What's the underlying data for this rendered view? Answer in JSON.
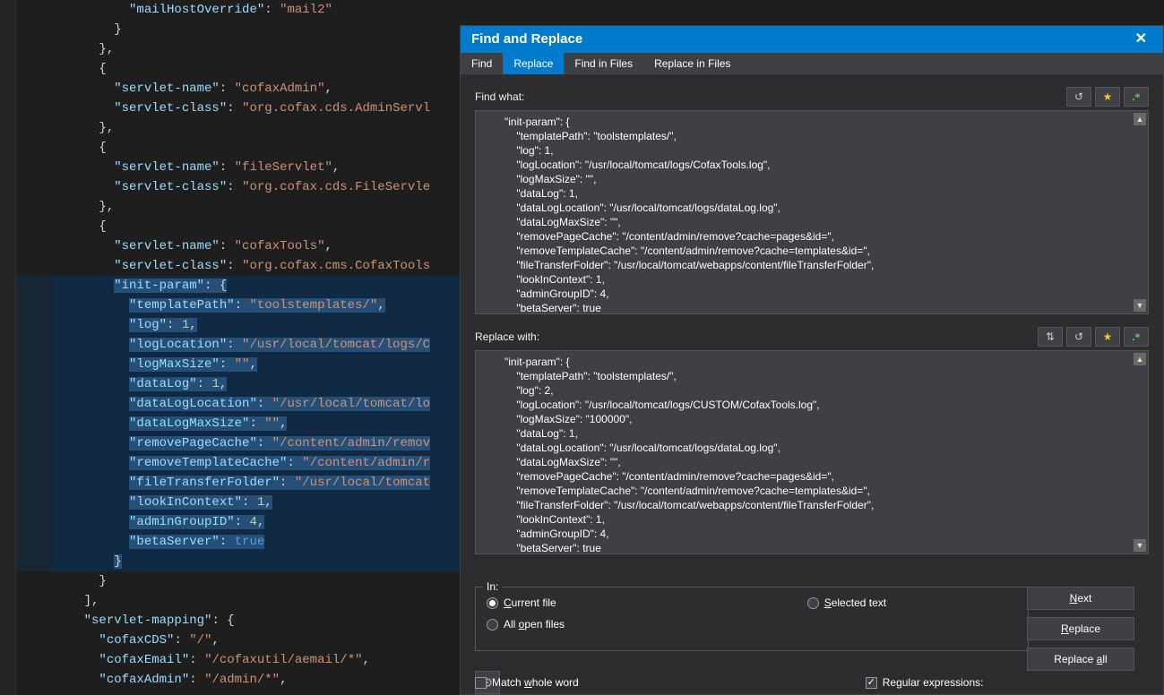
{
  "editor": {
    "lines": [
      {
        "indent": 5,
        "tokens": [
          {
            "t": "key",
            "v": "\"mailHostOverride\""
          },
          {
            "t": "punct",
            "v": ": "
          },
          {
            "t": "string",
            "v": "\"mail2\""
          }
        ]
      },
      {
        "indent": 4,
        "tokens": [
          {
            "t": "punct",
            "v": "}"
          }
        ]
      },
      {
        "indent": 3,
        "tokens": [
          {
            "t": "punct",
            "v": "},"
          }
        ]
      },
      {
        "indent": 3,
        "tokens": [
          {
            "t": "punct",
            "v": "{"
          }
        ]
      },
      {
        "indent": 4,
        "tokens": [
          {
            "t": "key",
            "v": "\"servlet-name\""
          },
          {
            "t": "punct",
            "v": ": "
          },
          {
            "t": "string",
            "v": "\"cofaxAdmin\""
          },
          {
            "t": "punct",
            "v": ","
          }
        ]
      },
      {
        "indent": 4,
        "tokens": [
          {
            "t": "key",
            "v": "\"servlet-class\""
          },
          {
            "t": "punct",
            "v": ": "
          },
          {
            "t": "string",
            "v": "\"org.cofax.cds.AdminServl"
          }
        ]
      },
      {
        "indent": 3,
        "tokens": [
          {
            "t": "punct",
            "v": "},"
          }
        ]
      },
      {
        "indent": 3,
        "tokens": [
          {
            "t": "punct",
            "v": "{"
          }
        ]
      },
      {
        "indent": 4,
        "tokens": [
          {
            "t": "key",
            "v": "\"servlet-name\""
          },
          {
            "t": "punct",
            "v": ": "
          },
          {
            "t": "string",
            "v": "\"fileServlet\""
          },
          {
            "t": "punct",
            "v": ","
          }
        ]
      },
      {
        "indent": 4,
        "tokens": [
          {
            "t": "key",
            "v": "\"servlet-class\""
          },
          {
            "t": "punct",
            "v": ": "
          },
          {
            "t": "string",
            "v": "\"org.cofax.cds.FileServle"
          }
        ]
      },
      {
        "indent": 3,
        "tokens": [
          {
            "t": "punct",
            "v": "},"
          }
        ]
      },
      {
        "indent": 3,
        "tokens": [
          {
            "t": "punct",
            "v": "{"
          }
        ]
      },
      {
        "indent": 4,
        "tokens": [
          {
            "t": "key",
            "v": "\"servlet-name\""
          },
          {
            "t": "punct",
            "v": ": "
          },
          {
            "t": "string",
            "v": "\"cofaxTools\""
          },
          {
            "t": "punct",
            "v": ","
          }
        ]
      },
      {
        "indent": 4,
        "tokens": [
          {
            "t": "key",
            "v": "\"servlet-class\""
          },
          {
            "t": "punct",
            "v": ": "
          },
          {
            "t": "string",
            "v": "\"org.cofax.cms.CofaxTools"
          }
        ]
      },
      {
        "indent": 4,
        "sel": true,
        "tokens": [
          {
            "t": "key",
            "v": "\"init-param\""
          },
          {
            "t": "punct",
            "v": ": {"
          }
        ]
      },
      {
        "indent": 5,
        "sel": true,
        "tokens": [
          {
            "t": "key",
            "v": "\"templatePath\""
          },
          {
            "t": "punct",
            "v": ": "
          },
          {
            "t": "string",
            "v": "\"toolstemplates/\""
          },
          {
            "t": "punct",
            "v": ","
          }
        ]
      },
      {
        "indent": 5,
        "sel": true,
        "tokens": [
          {
            "t": "key",
            "v": "\"log\""
          },
          {
            "t": "punct",
            "v": ": "
          },
          {
            "t": "number",
            "v": "1"
          },
          {
            "t": "punct",
            "v": ","
          }
        ]
      },
      {
        "indent": 5,
        "sel": true,
        "tokens": [
          {
            "t": "key",
            "v": "\"logLocation\""
          },
          {
            "t": "punct",
            "v": ": "
          },
          {
            "t": "string",
            "v": "\"/usr/local/tomcat/logs/C"
          }
        ]
      },
      {
        "indent": 5,
        "sel": true,
        "tokens": [
          {
            "t": "key",
            "v": "\"logMaxSize\""
          },
          {
            "t": "punct",
            "v": ": "
          },
          {
            "t": "string",
            "v": "\"\""
          },
          {
            "t": "punct",
            "v": ","
          }
        ]
      },
      {
        "indent": 5,
        "sel": true,
        "tokens": [
          {
            "t": "key",
            "v": "\"dataLog\""
          },
          {
            "t": "punct",
            "v": ": "
          },
          {
            "t": "number",
            "v": "1"
          },
          {
            "t": "punct",
            "v": ","
          }
        ]
      },
      {
        "indent": 5,
        "sel": true,
        "tokens": [
          {
            "t": "key",
            "v": "\"dataLogLocation\""
          },
          {
            "t": "punct",
            "v": ": "
          },
          {
            "t": "string",
            "v": "\"/usr/local/tomcat/lo"
          }
        ]
      },
      {
        "indent": 5,
        "sel": true,
        "tokens": [
          {
            "t": "key",
            "v": "\"dataLogMaxSize\""
          },
          {
            "t": "punct",
            "v": ": "
          },
          {
            "t": "string",
            "v": "\"\""
          },
          {
            "t": "punct",
            "v": ","
          }
        ]
      },
      {
        "indent": 5,
        "sel": true,
        "tokens": [
          {
            "t": "key",
            "v": "\"removePageCache\""
          },
          {
            "t": "punct",
            "v": ": "
          },
          {
            "t": "string",
            "v": "\"/content/admin/remov"
          }
        ]
      },
      {
        "indent": 5,
        "sel": true,
        "tokens": [
          {
            "t": "key",
            "v": "\"removeTemplateCache\""
          },
          {
            "t": "punct",
            "v": ": "
          },
          {
            "t": "string",
            "v": "\"/content/admin/r"
          }
        ]
      },
      {
        "indent": 5,
        "sel": true,
        "tokens": [
          {
            "t": "key",
            "v": "\"fileTransferFolder\""
          },
          {
            "t": "punct",
            "v": ": "
          },
          {
            "t": "string",
            "v": "\"/usr/local/tomcat"
          }
        ]
      },
      {
        "indent": 5,
        "sel": true,
        "tokens": [
          {
            "t": "key",
            "v": "\"lookInContext\""
          },
          {
            "t": "punct",
            "v": ": "
          },
          {
            "t": "number",
            "v": "1"
          },
          {
            "t": "punct",
            "v": ","
          }
        ]
      },
      {
        "indent": 5,
        "sel": true,
        "tokens": [
          {
            "t": "key",
            "v": "\"adminGroupID\""
          },
          {
            "t": "punct",
            "v": ": "
          },
          {
            "t": "number",
            "v": "4"
          },
          {
            "t": "punct",
            "v": ","
          }
        ]
      },
      {
        "indent": 5,
        "sel": true,
        "tokens": [
          {
            "t": "key",
            "v": "\"betaServer\""
          },
          {
            "t": "punct",
            "v": ": "
          },
          {
            "t": "kw",
            "v": "true"
          }
        ]
      },
      {
        "indent": 4,
        "sel": true,
        "tokens": [
          {
            "t": "punct",
            "v": "}"
          }
        ]
      },
      {
        "indent": 3,
        "tokens": [
          {
            "t": "punct",
            "v": "}"
          }
        ]
      },
      {
        "indent": 2,
        "tokens": [
          {
            "t": "punct",
            "v": "],"
          }
        ]
      },
      {
        "indent": 2,
        "tokens": [
          {
            "t": "key",
            "v": "\"servlet-mapping\""
          },
          {
            "t": "punct",
            "v": ": {"
          }
        ]
      },
      {
        "indent": 3,
        "tokens": [
          {
            "t": "key",
            "v": "\"cofaxCDS\""
          },
          {
            "t": "punct",
            "v": ": "
          },
          {
            "t": "string",
            "v": "\"/\""
          },
          {
            "t": "punct",
            "v": ","
          }
        ]
      },
      {
        "indent": 3,
        "tokens": [
          {
            "t": "key",
            "v": "\"cofaxEmail\""
          },
          {
            "t": "punct",
            "v": ": "
          },
          {
            "t": "string",
            "v": "\"/cofaxutil/aemail/*\""
          },
          {
            "t": "punct",
            "v": ","
          }
        ]
      },
      {
        "indent": 3,
        "tokens": [
          {
            "t": "key",
            "v": "\"cofaxAdmin\""
          },
          {
            "t": "punct",
            "v": ": "
          },
          {
            "t": "string",
            "v": "\"/admin/*\""
          },
          {
            "t": "punct",
            "v": ","
          }
        ]
      }
    ]
  },
  "dialog": {
    "title": "Find and Replace",
    "tabs": {
      "find": "Find",
      "replace": "Replace",
      "findfiles": "Find in Files",
      "replacefiles": "Replace in Files",
      "active": "replace"
    },
    "find_label": "Find what:",
    "replace_label": "Replace with:",
    "find_text": "\"init-param\": {\n    \"templatePath\": \"toolstemplates/\",\n    \"log\": 1,\n    \"logLocation\": \"/usr/local/tomcat/logs/CofaxTools.log\",\n    \"logMaxSize\": \"\",\n    \"dataLog\": 1,\n    \"dataLogLocation\": \"/usr/local/tomcat/logs/dataLog.log\",\n    \"dataLogMaxSize\": \"\",\n    \"removePageCache\": \"/content/admin/remove?cache=pages&id=\",\n    \"removeTemplateCache\": \"/content/admin/remove?cache=templates&id=\",\n    \"fileTransferFolder\": \"/usr/local/tomcat/webapps/content/fileTransferFolder\",\n    \"lookInContext\": 1,\n    \"adminGroupID\": 4,\n    \"betaServer\": true",
    "replace_text": "\"init-param\": {\n    \"templatePath\": \"toolstemplates/\",\n    \"log\": 2,\n    \"logLocation\": \"/usr/local/tomcat/logs/CUSTOM/CofaxTools.log\",\n    \"logMaxSize\": \"100000\",\n    \"dataLog\": 1,\n    \"dataLogLocation\": \"/usr/local/tomcat/logs/dataLog.log\",\n    \"dataLogMaxSize\": \"\",\n    \"removePageCache\": \"/content/admin/remove?cache=pages&id=\",\n    \"removeTemplateCache\": \"/content/admin/remove?cache=templates&id=\",\n    \"fileTransferFolder\": \"/usr/local/tomcat/webapps/content/fileTransferFolder\",\n    \"lookInContext\": 1,\n    \"adminGroupID\": 4,\n    \"betaServer\": true",
    "in_label": "In:",
    "scope": {
      "current": "Current file",
      "selected": "Selected text",
      "allopen": "All open files",
      "value": "current"
    },
    "options": {
      "match_whole": "Match whole word",
      "regex": "Regular expressions:",
      "regex_checked": true,
      "match_whole_checked": false
    },
    "buttons": {
      "next": "Next",
      "replace": "Replace",
      "replace_all": "Replace all"
    }
  }
}
